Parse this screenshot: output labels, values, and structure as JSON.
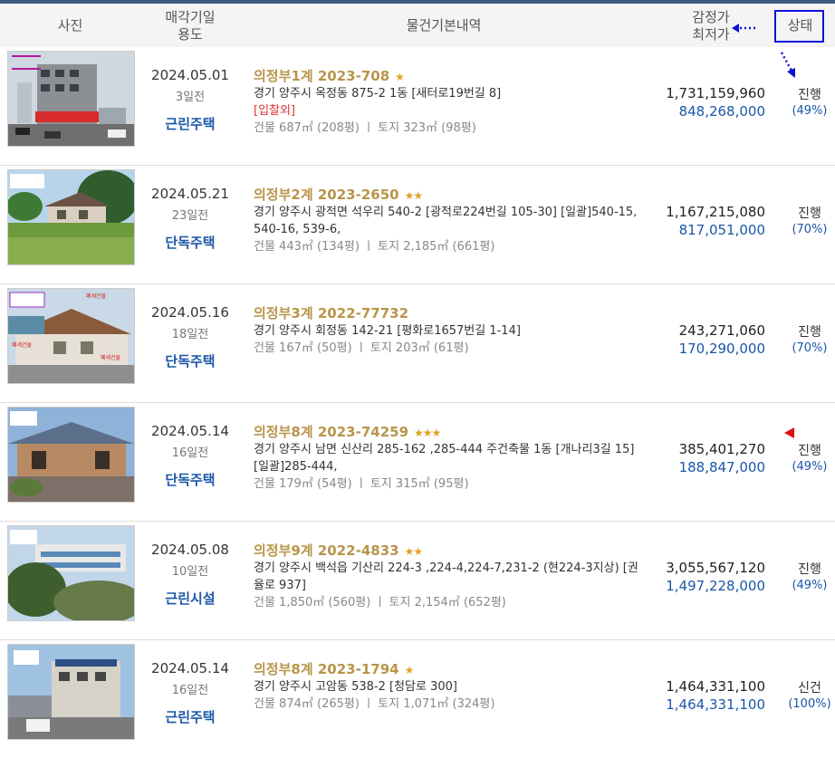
{
  "header": {
    "photo": "사진",
    "date_line1": "매각기일",
    "date_line2": "용도",
    "info": "물건기본내역",
    "price_line1": "감정가",
    "price_line2": "최저가",
    "status": "상태"
  },
  "rows": [
    {
      "date": "2024.05.01",
      "days": "3일전",
      "usage": "근린주택",
      "case": "의정부1계 2023-708",
      "stars": "★",
      "addr": "경기 양주시 옥정동 875-2 1동 [새터로19번길 8]",
      "tag": "[입찰외]",
      "area": "건물 687㎡ (208평)  ㅣ  토지 323㎡ (98평)",
      "appraisal": "1,731,159,960",
      "minimum": "848,268,000",
      "status": "진행",
      "percent": "(49%)"
    },
    {
      "date": "2024.05.21",
      "days": "23일전",
      "usage": "단독주택",
      "case": "의정부2계 2023-2650",
      "stars": "★★",
      "addr": "경기 양주시 광적면 석우리 540-2 [광적로224번길 105-30] [일괄]540-15, 540-16, 539-6,",
      "tag": "",
      "area": "건물 443㎡ (134평)  ㅣ  토지 2,185㎡ (661평)",
      "appraisal": "1,167,215,080",
      "minimum": "817,051,000",
      "status": "진행",
      "percent": "(70%)"
    },
    {
      "date": "2024.05.16",
      "days": "18일전",
      "usage": "단독주택",
      "case": "의정부3계 2022-77732",
      "stars": "",
      "addr": "경기 양주시 회정동 142-21 [평화로1657번길 1-14]",
      "tag": "",
      "area": "건물 167㎡ (50평)  ㅣ  토지 203㎡ (61평)",
      "appraisal": "243,271,060",
      "minimum": "170,290,000",
      "status": "진행",
      "percent": "(70%)"
    },
    {
      "date": "2024.05.14",
      "days": "16일전",
      "usage": "단독주택",
      "case": "의정부8계 2023-74259",
      "stars": "★★★",
      "addr": "경기 양주시 남면 신산리 285-162 ,285-444 주건축물 1동 [개나리3길 15] [일괄]285-444,",
      "tag": "",
      "area": "건물 179㎡ (54평)  ㅣ  토지 315㎡ (95평)",
      "appraisal": "385,401,270",
      "minimum": "188,847,000",
      "status": "진행",
      "percent": "(49%)"
    },
    {
      "date": "2024.05.08",
      "days": "10일전",
      "usage": "근린시설",
      "case": "의정부9계 2022-4833",
      "stars": "★★",
      "addr": "경기 양주시 백석읍 기산리 224-3 ,224-4,224-7,231-2 (현224-3지상) [권율로 937]",
      "tag": "",
      "area": "건물 1,850㎡ (560평)  ㅣ  토지 2,154㎡ (652평)",
      "appraisal": "3,055,567,120",
      "minimum": "1,497,228,000",
      "status": "진행",
      "percent": "(49%)"
    },
    {
      "date": "2024.05.14",
      "days": "16일전",
      "usage": "근린주택",
      "case": "의정부8계 2023-1794",
      "stars": "★",
      "addr": "경기 양주시 고암동 538-2 [청담로 300]",
      "tag": "",
      "area": "건물 874㎡ (265평)  ㅣ  토지 1,071㎡ (324평)",
      "appraisal": "1,464,331,100",
      "minimum": "1,464,331,100",
      "status": "신건",
      "percent": "(100%)"
    }
  ],
  "photo_labels": {
    "row3_a": "폐세건물",
    "row3_b": "폐세건물",
    "row3_c": "폐세건물"
  },
  "icons": {
    "status_box": "highlight-box",
    "arrows": "dotted-arrow-icon",
    "triangle": "red-triangle-icon"
  }
}
